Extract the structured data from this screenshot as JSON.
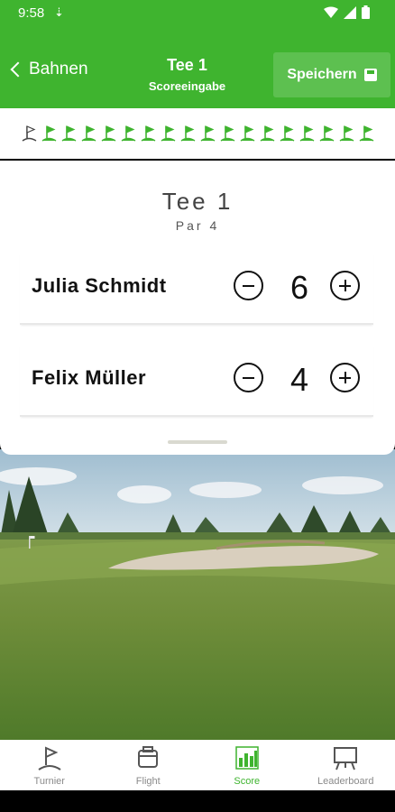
{
  "status": {
    "time": "9:58"
  },
  "header": {
    "back_label": "Bahnen",
    "title": "Tee 1",
    "subtitle": "Scoreeingabe",
    "save_label": "Speichern"
  },
  "holes": {
    "count": 18,
    "current": 1
  },
  "card": {
    "tee": "Tee 1",
    "par": "Par 4",
    "players": [
      {
        "name": "Julia Schmidt",
        "score": "6"
      },
      {
        "name": "Felix Müller",
        "score": "4"
      }
    ]
  },
  "nav": {
    "items": [
      {
        "label": "Turnier",
        "icon": "flag-icon"
      },
      {
        "label": "Flight",
        "icon": "cart-icon"
      },
      {
        "label": "Score",
        "icon": "bar-chart-icon"
      },
      {
        "label": "Leaderboard",
        "icon": "board-icon"
      }
    ],
    "active": "Score"
  },
  "colors": {
    "brand": "#3fb42f",
    "white": "#ffffff"
  }
}
